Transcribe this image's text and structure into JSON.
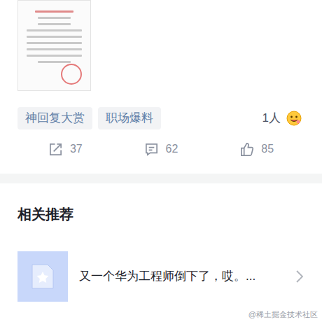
{
  "tags": [
    {
      "label": "神回复大赏"
    },
    {
      "label": "职场爆料"
    }
  ],
  "reactions": {
    "count": "1人"
  },
  "actions": [
    {
      "kind": "share",
      "count": "37"
    },
    {
      "kind": "comment",
      "count": "62"
    },
    {
      "kind": "like",
      "count": "85"
    }
  ],
  "related": {
    "title": "相关推荐",
    "items": [
      {
        "title": "又一个华为工程师倒下了，哎。..."
      }
    ]
  },
  "watermark": "@稀土掘金技术社区"
}
